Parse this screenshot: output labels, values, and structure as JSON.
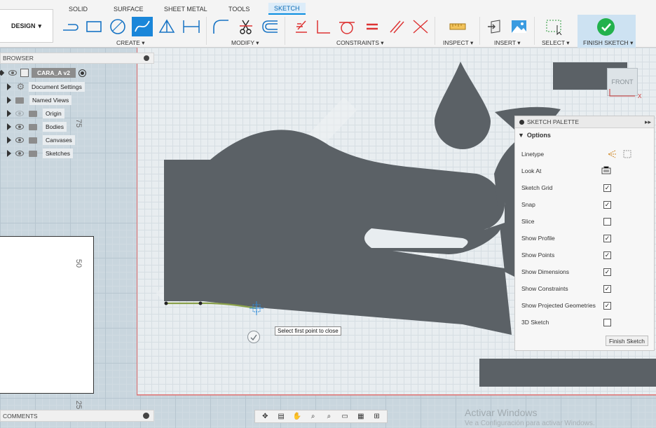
{
  "design_menu": {
    "label": "DESIGN"
  },
  "tabs": [
    "SOLID",
    "SURFACE",
    "SHEET METAL",
    "TOOLS",
    "SKETCH"
  ],
  "active_tab": "SKETCH",
  "groups": {
    "create": "CREATE",
    "modify": "MODIFY",
    "constraints": "CONSTRAINTS",
    "inspect": "INSPECT",
    "insert": "INSERT",
    "select": "SELECT",
    "finish": "FINISH SKETCH"
  },
  "browser": {
    "title": "BROWSER",
    "root": "CARA_A v2",
    "items": [
      "Document Settings",
      "Named Views",
      "Origin",
      "Bodies",
      "Canvases",
      "Sketches"
    ]
  },
  "ruler": {
    "mark_75": "75",
    "mark_50": "50",
    "mark_25": "25"
  },
  "viewcube": {
    "label": "FRONT"
  },
  "palette": {
    "title": "SKETCH PALETTE",
    "section": "Options",
    "rows": [
      {
        "label": "Linetype",
        "type": "icons"
      },
      {
        "label": "Look At",
        "type": "icon"
      },
      {
        "label": "Sketch Grid",
        "checked": true
      },
      {
        "label": "Snap",
        "checked": true
      },
      {
        "label": "Slice",
        "checked": false
      },
      {
        "label": "Show Profile",
        "checked": true
      },
      {
        "label": "Show Points",
        "checked": true
      },
      {
        "label": "Show Dimensions",
        "checked": true
      },
      {
        "label": "Show Constraints",
        "checked": true
      },
      {
        "label": "Show Projected Geometries",
        "checked": true
      },
      {
        "label": "3D Sketch",
        "checked": false
      }
    ],
    "finish_button": "Finish Sketch"
  },
  "tooltip": "Select first point to close",
  "comments": {
    "title": "COMMENTS"
  },
  "watermark": {
    "line1": "Activar Windows",
    "line2": "Ve a Configuración para activar Windows."
  },
  "colors": {
    "accent": "#1a86d9",
    "finish_green": "#22b14c",
    "art_fill": "#5b6166",
    "sketch_line": "#8aa04a"
  }
}
